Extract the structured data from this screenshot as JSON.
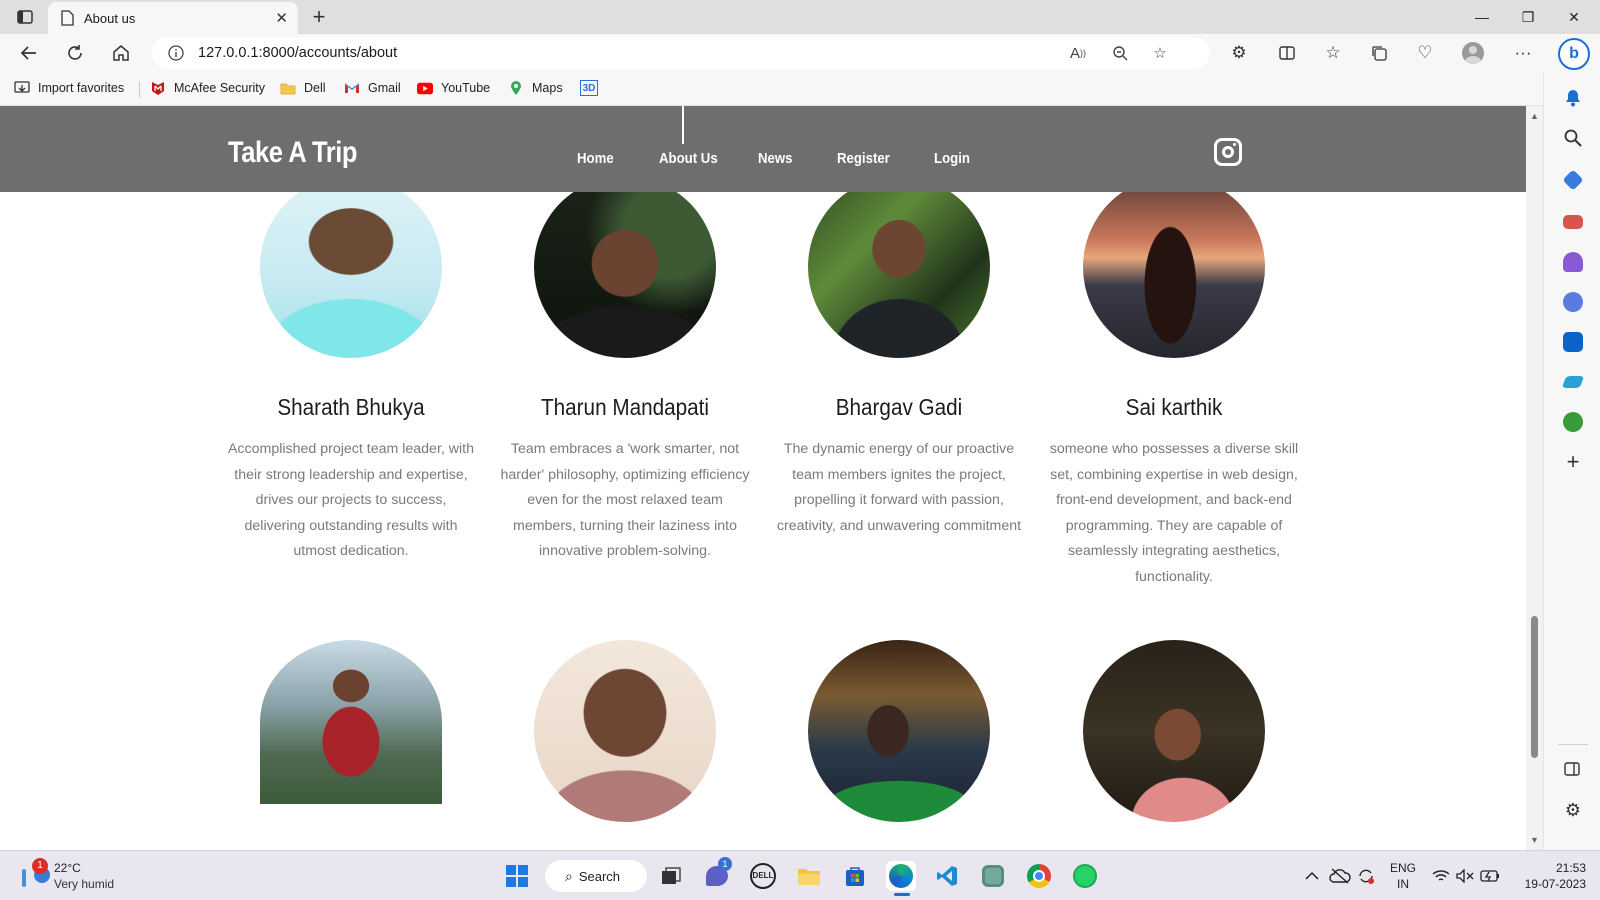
{
  "browser": {
    "tab_title": "About us",
    "url": "127.0.0.1:8000/accounts/about",
    "favorites": [
      {
        "label": "Import favorites",
        "icon": "import-icon"
      },
      {
        "label": "McAfee Security",
        "icon": "mcafee-icon"
      },
      {
        "label": "Dell",
        "icon": "folder-icon"
      },
      {
        "label": "Gmail",
        "icon": "gmail-icon"
      },
      {
        "label": "YouTube",
        "icon": "youtube-icon"
      },
      {
        "label": "Maps",
        "icon": "maps-icon"
      },
      {
        "label": "",
        "icon": "3d-icon"
      }
    ]
  },
  "site": {
    "brand": "Take A Trip",
    "nav": [
      "Home",
      "About Us",
      "News",
      "Register",
      "Login"
    ],
    "active_nav": "About Us"
  },
  "team": [
    {
      "name": "Sharath Bhukya",
      "bio": "Accomplished project team leader, with their strong leadership and expertise, drives our projects to success, delivering outstanding results with utmost dedication."
    },
    {
      "name": "Tharun Mandapati",
      "bio": "Team embraces a 'work smarter, not harder' philosophy, optimizing efficiency even for the most relaxed team members, turning their laziness into innovative problem-solving."
    },
    {
      "name": "Bhargav Gadi",
      "bio": "The dynamic energy of our proactive team members ignites the project, propelling it forward with passion, creativity, and unwavering commitment"
    },
    {
      "name": "Sai karthik",
      "bio": "someone who possesses a diverse skill set, combining expertise in web design, front-end development, and back-end programming. They are capable of seamlessly integrating aesthetics, functionality."
    }
  ],
  "taskbar": {
    "weather_temp": "22°C",
    "weather_desc": "Very humid",
    "weather_badge": "1",
    "search_label": "Search",
    "chat_badge": "1",
    "lang": "ENG",
    "region": "IN",
    "time": "21:53",
    "date": "19-07-2023"
  },
  "colors": {
    "header_bg": "#6e6e6e",
    "bio_text": "#7a7a7a",
    "taskbar_bg": "#e9e6ef"
  }
}
